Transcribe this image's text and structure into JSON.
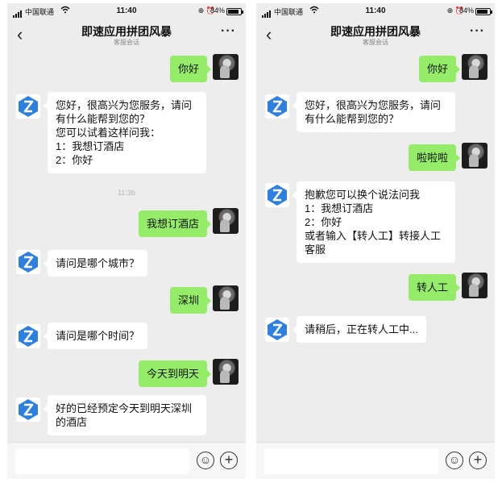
{
  "colors": {
    "user_bubble": "#95ec69",
    "bot_bubble": "#ffffff",
    "chat_bg": "#ededed",
    "bot_logo": "#2d7fe0"
  },
  "status": {
    "carrier": "中国联通",
    "wifi_icon": "wifi-icon",
    "time": "11:40",
    "battery": "84%"
  },
  "nav": {
    "back": "‹",
    "title": "即速应用拼团风暴",
    "subtitle": "客服会话",
    "more": "···"
  },
  "left": {
    "u1": "你好",
    "b1": [
      "您好，很高兴为您服务，请问",
      "有什么能帮到您的？",
      "您可以试着这样问我：",
      "1：我想订酒店",
      "2：你好"
    ],
    "timestamp": "11:3b",
    "u2": "我想订酒店",
    "b2": "请问是哪个城市？",
    "u3": "深圳",
    "b3": "请问是哪个时间？",
    "u4": "今天到明天",
    "b4": [
      "好的已经预定今天到明天深圳",
      "的酒店"
    ]
  },
  "right": {
    "u1": "你好",
    "b1": [
      "您好，很高兴为您服务，请问",
      "有什么能帮到您的？"
    ],
    "u2": "啦啦啦",
    "b2": [
      "抱歉您可以换个说法问我",
      "1：我想订酒店",
      "2：你好",
      "或者输入【转人工】转接人工",
      "客服"
    ],
    "u3": "转人工",
    "b3": "请稍后，正在转人工中..."
  },
  "input": {
    "emoji_icon": "☺",
    "plus_icon": "+"
  }
}
